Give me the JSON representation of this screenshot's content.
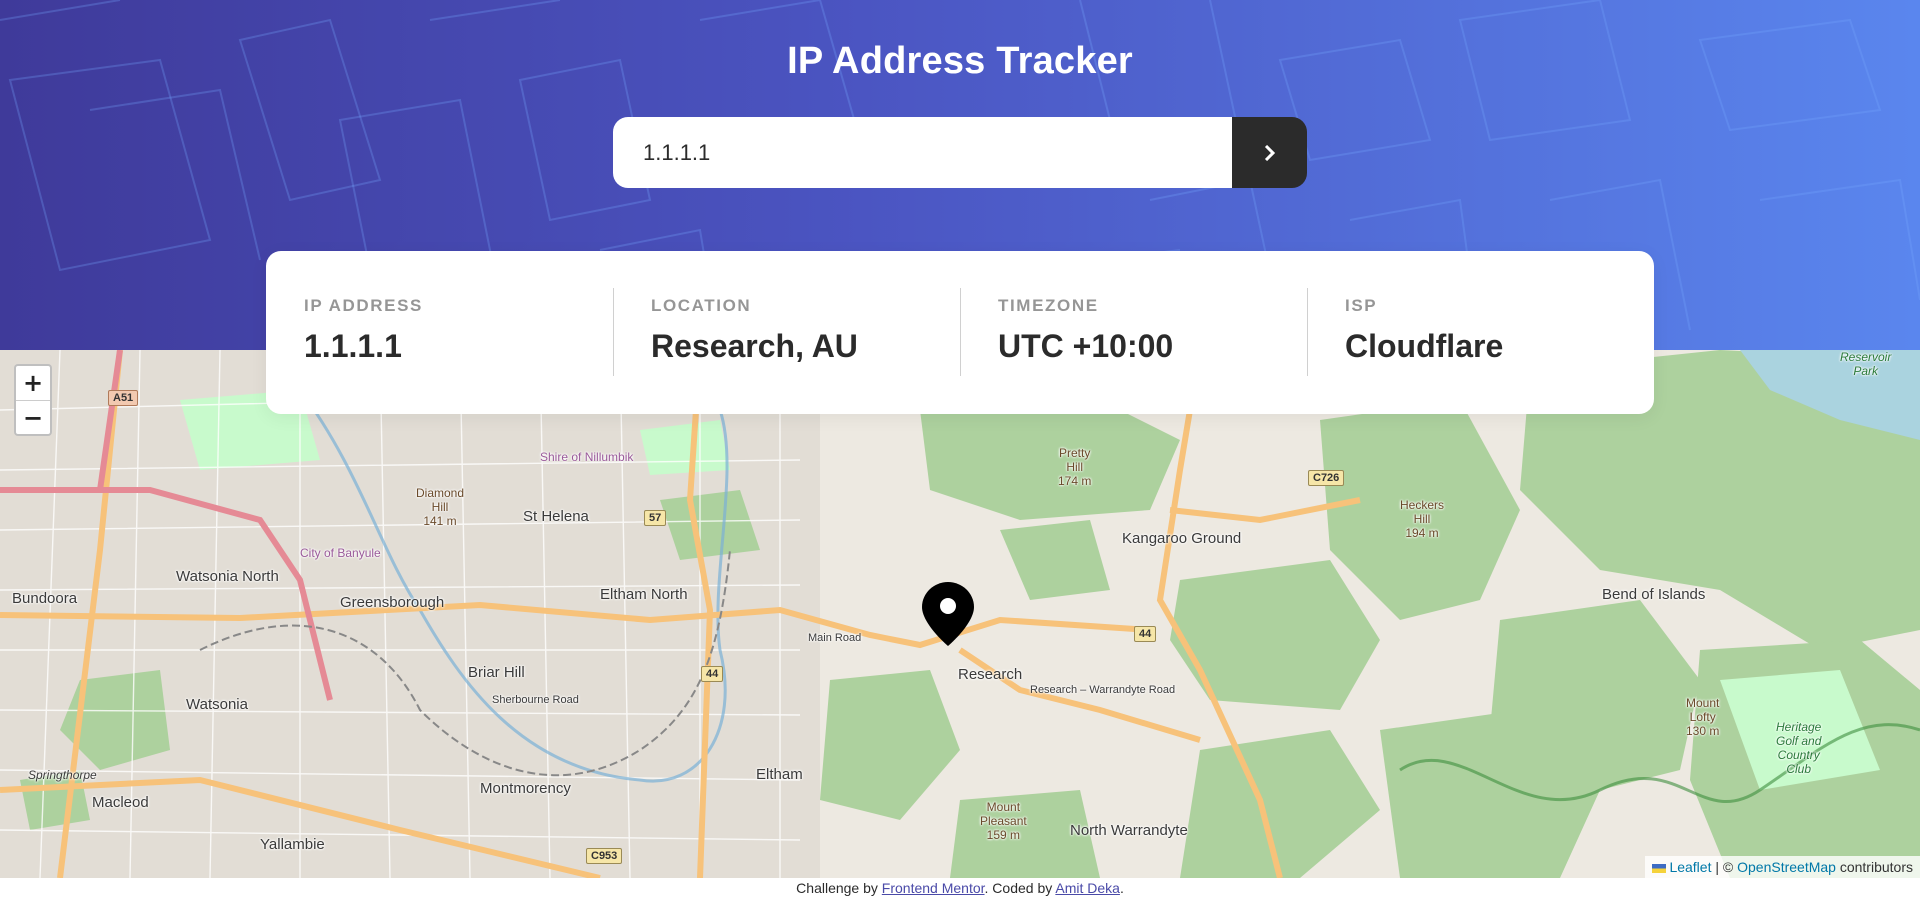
{
  "header": {
    "title": "IP Address Tracker",
    "search": {
      "value": "1.1.1.1",
      "button_icon": "chevron-right-icon"
    },
    "colors": {
      "gradient_start": "#3f3a9a",
      "gradient_end": "#5a86ee",
      "button": "#2b2b2b"
    }
  },
  "info": {
    "ip_label": "IP ADDRESS",
    "ip_value": "1.1.1.1",
    "location_label": "LOCATION",
    "location_value": "Research, AU",
    "timezone_label": "TIMEZONE",
    "timezone_value": "UTC +10:00",
    "isp_label": "ISP",
    "isp_value": "Cloudflare"
  },
  "map": {
    "zoom_in": "+",
    "zoom_out": "−",
    "marker_icon": "location-pin-icon",
    "places": {
      "bundoora": "Bundoora",
      "watsonia_north": "Watsonia North",
      "greensborough": "Greensborough",
      "st_helena": "St Helena",
      "eltham_north": "Eltham North",
      "briar_hill": "Briar Hill",
      "watsonia": "Watsonia",
      "macleod": "Macleod",
      "yallambie": "Yallambie",
      "montmorency": "Montmorency",
      "eltham": "Eltham",
      "research": "Research",
      "kangaroo_ground": "Kangaroo Ground",
      "north_warrandyte": "North Warrandyte",
      "bend_of_islands": "Bend of Islands",
      "diamond_hill": "Diamond\nHill\n141 m",
      "pretty_hill": "Pretty\nHill\n174 m",
      "heckers_hill": "Heckers\nHill\n194 m",
      "mount_pleasant": "Mount\nPleasant\n159 m",
      "mount_lofty": "Mount\nLofty\n130 m",
      "reservoir_park": "Reservoir\nPark",
      "heritage": "Heritage\nGolf and\nCountry\nClub",
      "city_of_banyule": "City of Banyule",
      "shire_of_nillumbik": "Shire of Nillumbik",
      "springthorpe": "Springthorpe",
      "main_road": "Main Road",
      "sherbourne_road": "Sherbourne Road",
      "research_warrandyte_road": "Research – Warrandyte Road"
    },
    "shields": {
      "a51": "A51",
      "r57": "57",
      "r44a": "44",
      "r44b": "44",
      "c726": "C726",
      "c953": "C953"
    },
    "attribution": {
      "leaflet": "Leaflet",
      "sep": " | © ",
      "osm": "OpenStreetMap",
      "contributors": " contributors"
    }
  },
  "footer": {
    "prefix": "Challenge by ",
    "fm_link": "Frontend Mentor",
    "middle": ". Coded by ",
    "author_link": "Amit Deka",
    "suffix": "."
  }
}
